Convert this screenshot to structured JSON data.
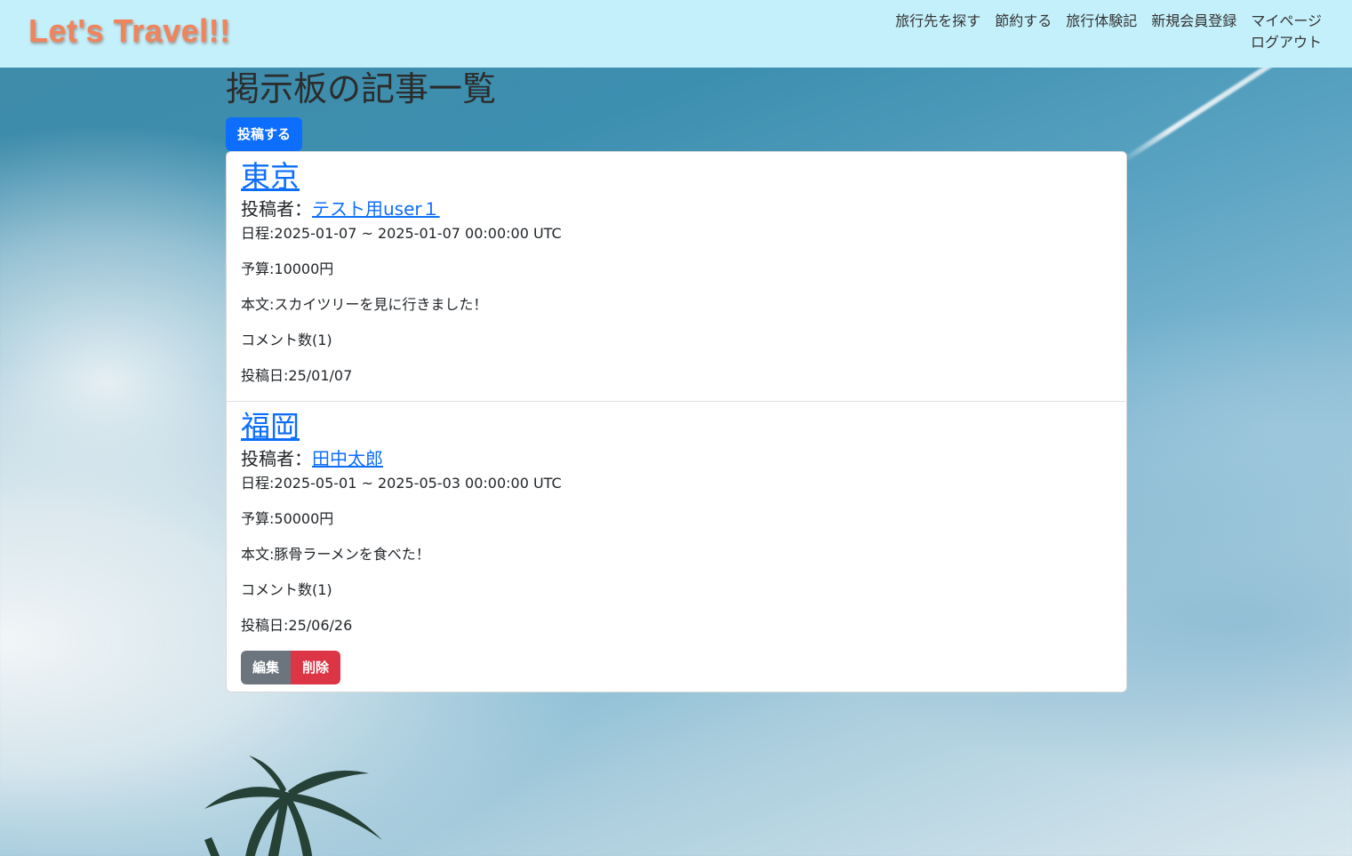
{
  "header": {
    "brand": "Let's Travel!!",
    "nav": [
      "旅行先を探す",
      "節約する",
      "旅行体験記",
      "新規会員登録",
      "マイページ",
      "ログアウト"
    ]
  },
  "main": {
    "title": "掲示板の記事一覧",
    "post_button": "投稿する",
    "posts": [
      {
        "title": "東京",
        "author_prefix": "投稿者：",
        "author": "テスト用user１",
        "schedule": "日程:2025-01-07 ~ 2025-01-07 00:00:00 UTC",
        "budget": "予算:10000円",
        "body": "本文:スカイツリーを見に行きました！",
        "comments": "コメント数(1)",
        "posted": "投稿日:25/01/07"
      },
      {
        "title": "福岡",
        "author_prefix": "投稿者：",
        "author": "田中太郎",
        "schedule": "日程:2025-05-01 ~ 2025-05-03 00:00:00 UTC",
        "budget": "予算:50000円",
        "body": "本文:豚骨ラーメンを食べた！",
        "comments": "コメント数(1)",
        "posted": "投稿日:25/06/26",
        "edit_label": "編集",
        "delete_label": "削除"
      }
    ]
  },
  "colors": {
    "header_bg": "#c4f0fb",
    "brand": "#f0845c",
    "link": "#0d6efd",
    "primary": "#0d6efd",
    "secondary": "#6c757d",
    "danger": "#dc3545"
  }
}
